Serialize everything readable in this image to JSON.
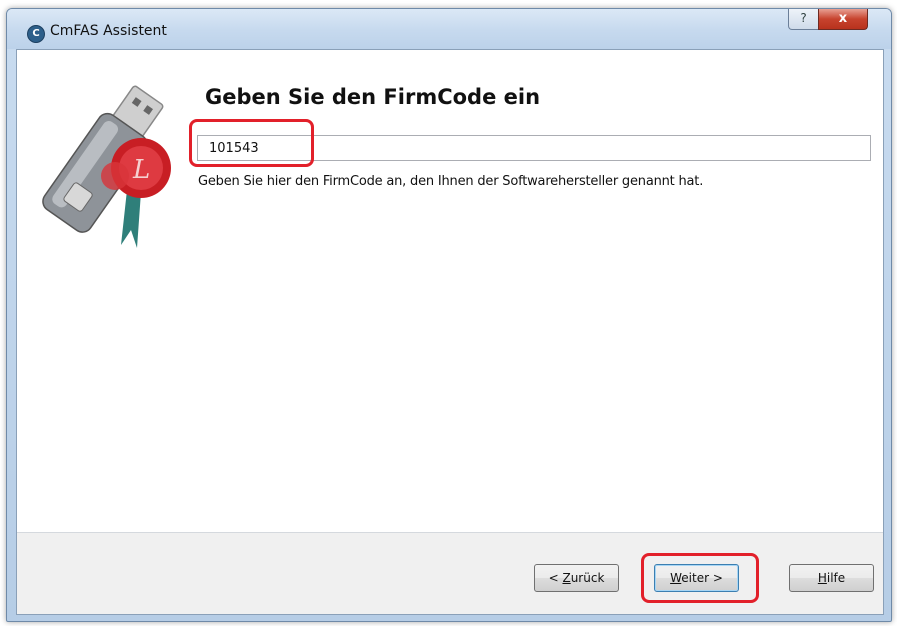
{
  "window": {
    "title": "CmFAS Assistent",
    "icon": "cmfas-app-icon"
  },
  "titlebar": {
    "help_label": "?",
    "close_label": "x"
  },
  "main": {
    "heading": "Geben Sie den FirmCode ein",
    "firmcode_value": "101543",
    "hint": "Geben Sie hier den FirmCode an, den Ihnen der Softwarehersteller genannt hat."
  },
  "buttons": {
    "back": {
      "prefix": "< ",
      "mnemonic": "Z",
      "rest": "urück"
    },
    "next": {
      "mnemonic": "W",
      "rest": "eiter >"
    },
    "help": {
      "mnemonic": "H",
      "rest": "ilfe"
    }
  },
  "colors": {
    "highlight": "#e2202a",
    "accent": "#3c7fb1"
  }
}
